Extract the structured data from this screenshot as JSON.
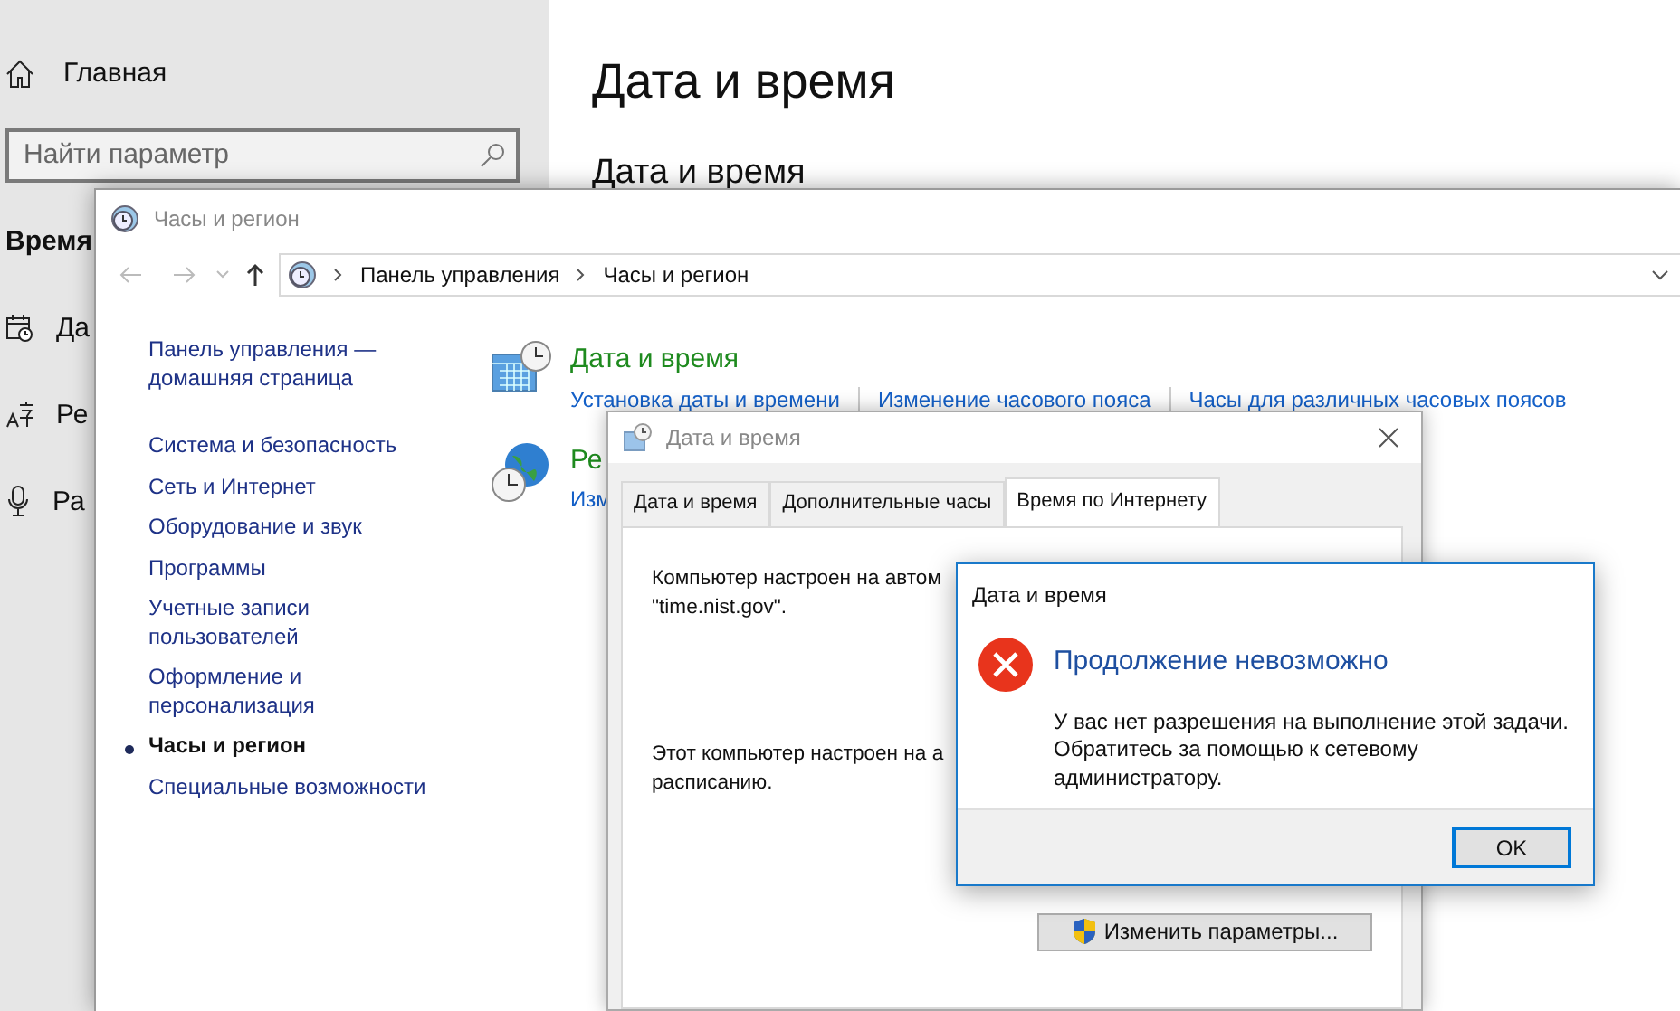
{
  "settings": {
    "home": "Главная",
    "search": {
      "placeholder": "Найти параметр"
    },
    "section": "Время",
    "items": [
      {
        "label": "Да",
        "kind": "calendar"
      },
      {
        "label": "Ре",
        "kind": "language"
      },
      {
        "label": "Ра",
        "kind": "microphone"
      }
    ],
    "title": "Дата и время",
    "subtitle": "Дата и время"
  },
  "control_panel": {
    "title": "Часы и регион",
    "breadcrumb": [
      "Панель управления",
      "Часы и регион"
    ],
    "sidebar": [
      {
        "label": "Панель управления — домашняя страница",
        "selected": false
      },
      {
        "label": "Система и безопасность",
        "selected": false
      },
      {
        "label": "Сеть и Интернет",
        "selected": false
      },
      {
        "label": "Оборудование и звук",
        "selected": false
      },
      {
        "label": "Программы",
        "selected": false
      },
      {
        "label": "Учетные записи пользователей",
        "selected": false
      },
      {
        "label": "Оформление и персонализация",
        "selected": false
      },
      {
        "label": "Часы и регион",
        "selected": true
      },
      {
        "label": "Специальные возможности",
        "selected": false
      }
    ],
    "categories": [
      {
        "title": "Дата и время",
        "kind": "calendar",
        "links": [
          "Установка даты и времени",
          "Изменение часового пояса",
          "Часы для различных часовых поясов"
        ]
      },
      {
        "title": "Ре",
        "kind": "globe",
        "links": [
          "Изм"
        ]
      }
    ]
  },
  "date_time_dialog": {
    "title": "Дата и время",
    "tabs": [
      {
        "label": "Дата и время",
        "selected": false
      },
      {
        "label": "Дополнительные часы",
        "selected": false
      },
      {
        "label": "Время по Интернету",
        "selected": true
      }
    ],
    "paragraphs": [
      [
        "Компьютер настроен на автом",
        "\"time.nist.gov\"."
      ],
      [
        "Этот компьютер настроен на а",
        "расписанию."
      ]
    ],
    "button": "Изменить параметры..."
  },
  "error_dialog": {
    "title": "Дата и время",
    "heading": "Продолжение невозможно",
    "message": "У вас нет разрешения на выполнение этой задачи. Обратитесь за помощью к сетевому администратору.",
    "button": "OK"
  }
}
